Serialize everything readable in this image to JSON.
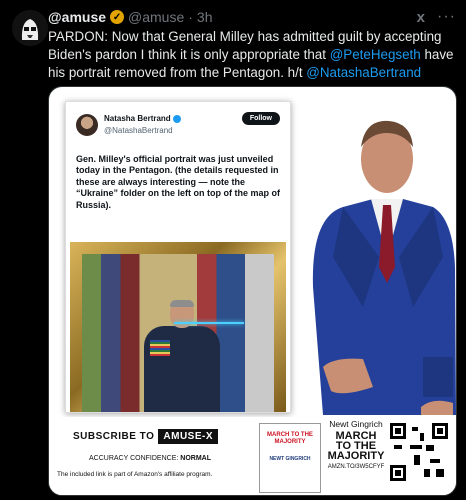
{
  "tweet": {
    "display_name": "@amuse",
    "handle": "@amuse",
    "dot": "·",
    "time": "3h",
    "grok": "x",
    "more": "···",
    "text_part1": "PARDON: Now that General Milley has admitted guilt by accepting Biden's pardon I think it is only appropriate that ",
    "mention1": "@PeteHegseth",
    "text_part2": " have his portrait removed from the Pentagon. h/t ",
    "mention2": "@NatashaBertrand"
  },
  "card": {
    "name": "Natasha Bertrand",
    "handle": "@NatashaBertrand",
    "follow": "Follow",
    "text": "Gen. Milley's official portrait was just unveiled today in the Pentagon. (the details requested in these are always interesting — note the “Ukraine” folder on the left on top of the map of Russia)."
  },
  "banner": {
    "subscribe": "SUBSCRIBE TO",
    "brand": "AMUSE-X",
    "accuracy_label": "ACCURACY CONFIDENCE:",
    "accuracy_value": "NORMAL",
    "affiliate": "The included link is part of Amazon's affiliate program.",
    "book_title": "MARCH TO THE MAJORITY",
    "book_author": "NEWT GINGRICH",
    "author": "Newt Gingrich",
    "title": "MARCH TO THE MAJORITY",
    "url": "AMZN.TO/3W5CFYF"
  },
  "colors": {
    "background": "#000000",
    "mention": "#1d9bf0",
    "verified_gold": "#e3a400"
  }
}
